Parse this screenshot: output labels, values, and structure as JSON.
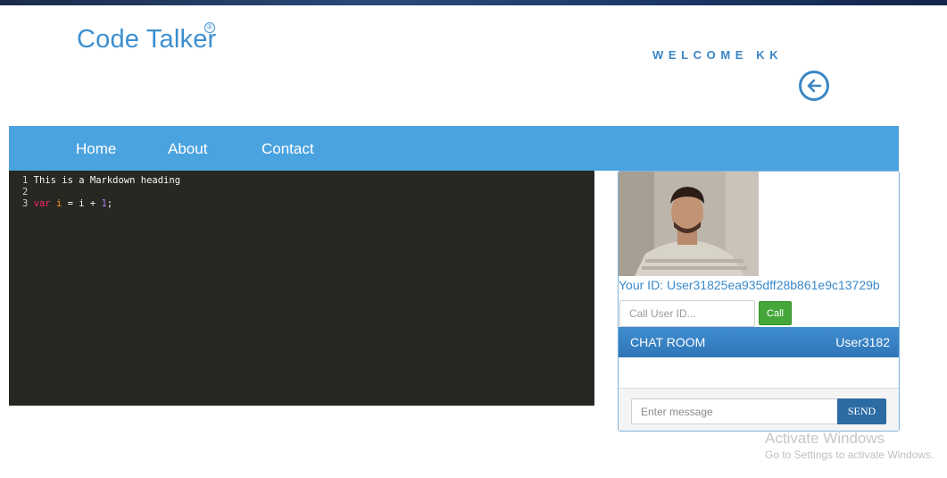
{
  "header": {
    "brand": "Code Talker",
    "brand_mark": "®",
    "welcome": "WELCOME KK"
  },
  "nav": {
    "items": [
      {
        "label": "Home"
      },
      {
        "label": "About"
      },
      {
        "label": "Contact"
      }
    ]
  },
  "editor": {
    "lines": [
      {
        "number": "1",
        "text": "This is a Markdown heading"
      },
      {
        "number": "2",
        "text": ""
      },
      {
        "number": "3",
        "keyword": "var",
        "variable": "i",
        "rest_before": " = i + ",
        "number_literal": "1",
        "rest_after": ";"
      }
    ]
  },
  "call": {
    "your_id": "Your ID: User31825ea935dff28b861e9c13729b",
    "input_placeholder": "Call User ID...",
    "button_label": "Call"
  },
  "chat": {
    "title": "CHAT ROOM",
    "user": "User3182",
    "input_placeholder": "Enter message",
    "send_label": "SEND"
  },
  "watermark": {
    "title": "Activate Windows",
    "subtitle": "Go to Settings to activate Windows."
  },
  "colors": {
    "nav_bg": "#4aa3df",
    "brand": "#3b8fd0",
    "editor_bg": "#272822",
    "call_button": "#45a73a",
    "chat_header": "#3f8dd0",
    "send_button": "#2c6ba3"
  },
  "icons": {
    "back": "arrow-left-circle-icon"
  }
}
